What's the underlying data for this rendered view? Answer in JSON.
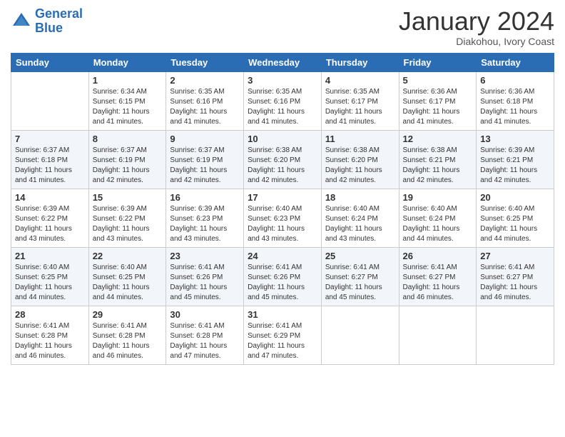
{
  "logo": {
    "line1": "General",
    "line2": "Blue"
  },
  "title": "January 2024",
  "subtitle": "Diakohou, Ivory Coast",
  "days_of_week": [
    "Sunday",
    "Monday",
    "Tuesday",
    "Wednesday",
    "Thursday",
    "Friday",
    "Saturday"
  ],
  "weeks": [
    [
      {
        "day": "",
        "text": ""
      },
      {
        "day": "1",
        "text": "Sunrise: 6:34 AM\nSunset: 6:15 PM\nDaylight: 11 hours\nand 41 minutes."
      },
      {
        "day": "2",
        "text": "Sunrise: 6:35 AM\nSunset: 6:16 PM\nDaylight: 11 hours\nand 41 minutes."
      },
      {
        "day": "3",
        "text": "Sunrise: 6:35 AM\nSunset: 6:16 PM\nDaylight: 11 hours\nand 41 minutes."
      },
      {
        "day": "4",
        "text": "Sunrise: 6:35 AM\nSunset: 6:17 PM\nDaylight: 11 hours\nand 41 minutes."
      },
      {
        "day": "5",
        "text": "Sunrise: 6:36 AM\nSunset: 6:17 PM\nDaylight: 11 hours\nand 41 minutes."
      },
      {
        "day": "6",
        "text": "Sunrise: 6:36 AM\nSunset: 6:18 PM\nDaylight: 11 hours\nand 41 minutes."
      }
    ],
    [
      {
        "day": "7",
        "text": "Sunrise: 6:37 AM\nSunset: 6:18 PM\nDaylight: 11 hours\nand 41 minutes."
      },
      {
        "day": "8",
        "text": "Sunrise: 6:37 AM\nSunset: 6:19 PM\nDaylight: 11 hours\nand 42 minutes."
      },
      {
        "day": "9",
        "text": "Sunrise: 6:37 AM\nSunset: 6:19 PM\nDaylight: 11 hours\nand 42 minutes."
      },
      {
        "day": "10",
        "text": "Sunrise: 6:38 AM\nSunset: 6:20 PM\nDaylight: 11 hours\nand 42 minutes."
      },
      {
        "day": "11",
        "text": "Sunrise: 6:38 AM\nSunset: 6:20 PM\nDaylight: 11 hours\nand 42 minutes."
      },
      {
        "day": "12",
        "text": "Sunrise: 6:38 AM\nSunset: 6:21 PM\nDaylight: 11 hours\nand 42 minutes."
      },
      {
        "day": "13",
        "text": "Sunrise: 6:39 AM\nSunset: 6:21 PM\nDaylight: 11 hours\nand 42 minutes."
      }
    ],
    [
      {
        "day": "14",
        "text": "Sunrise: 6:39 AM\nSunset: 6:22 PM\nDaylight: 11 hours\nand 43 minutes."
      },
      {
        "day": "15",
        "text": "Sunrise: 6:39 AM\nSunset: 6:22 PM\nDaylight: 11 hours\nand 43 minutes."
      },
      {
        "day": "16",
        "text": "Sunrise: 6:39 AM\nSunset: 6:23 PM\nDaylight: 11 hours\nand 43 minutes."
      },
      {
        "day": "17",
        "text": "Sunrise: 6:40 AM\nSunset: 6:23 PM\nDaylight: 11 hours\nand 43 minutes."
      },
      {
        "day": "18",
        "text": "Sunrise: 6:40 AM\nSunset: 6:24 PM\nDaylight: 11 hours\nand 43 minutes."
      },
      {
        "day": "19",
        "text": "Sunrise: 6:40 AM\nSunset: 6:24 PM\nDaylight: 11 hours\nand 44 minutes."
      },
      {
        "day": "20",
        "text": "Sunrise: 6:40 AM\nSunset: 6:25 PM\nDaylight: 11 hours\nand 44 minutes."
      }
    ],
    [
      {
        "day": "21",
        "text": "Sunrise: 6:40 AM\nSunset: 6:25 PM\nDaylight: 11 hours\nand 44 minutes."
      },
      {
        "day": "22",
        "text": "Sunrise: 6:40 AM\nSunset: 6:25 PM\nDaylight: 11 hours\nand 44 minutes."
      },
      {
        "day": "23",
        "text": "Sunrise: 6:41 AM\nSunset: 6:26 PM\nDaylight: 11 hours\nand 45 minutes."
      },
      {
        "day": "24",
        "text": "Sunrise: 6:41 AM\nSunset: 6:26 PM\nDaylight: 11 hours\nand 45 minutes."
      },
      {
        "day": "25",
        "text": "Sunrise: 6:41 AM\nSunset: 6:27 PM\nDaylight: 11 hours\nand 45 minutes."
      },
      {
        "day": "26",
        "text": "Sunrise: 6:41 AM\nSunset: 6:27 PM\nDaylight: 11 hours\nand 46 minutes."
      },
      {
        "day": "27",
        "text": "Sunrise: 6:41 AM\nSunset: 6:27 PM\nDaylight: 11 hours\nand 46 minutes."
      }
    ],
    [
      {
        "day": "28",
        "text": "Sunrise: 6:41 AM\nSunset: 6:28 PM\nDaylight: 11 hours\nand 46 minutes."
      },
      {
        "day": "29",
        "text": "Sunrise: 6:41 AM\nSunset: 6:28 PM\nDaylight: 11 hours\nand 46 minutes."
      },
      {
        "day": "30",
        "text": "Sunrise: 6:41 AM\nSunset: 6:28 PM\nDaylight: 11 hours\nand 47 minutes."
      },
      {
        "day": "31",
        "text": "Sunrise: 6:41 AM\nSunset: 6:29 PM\nDaylight: 11 hours\nand 47 minutes."
      },
      {
        "day": "",
        "text": ""
      },
      {
        "day": "",
        "text": ""
      },
      {
        "day": "",
        "text": ""
      }
    ]
  ]
}
